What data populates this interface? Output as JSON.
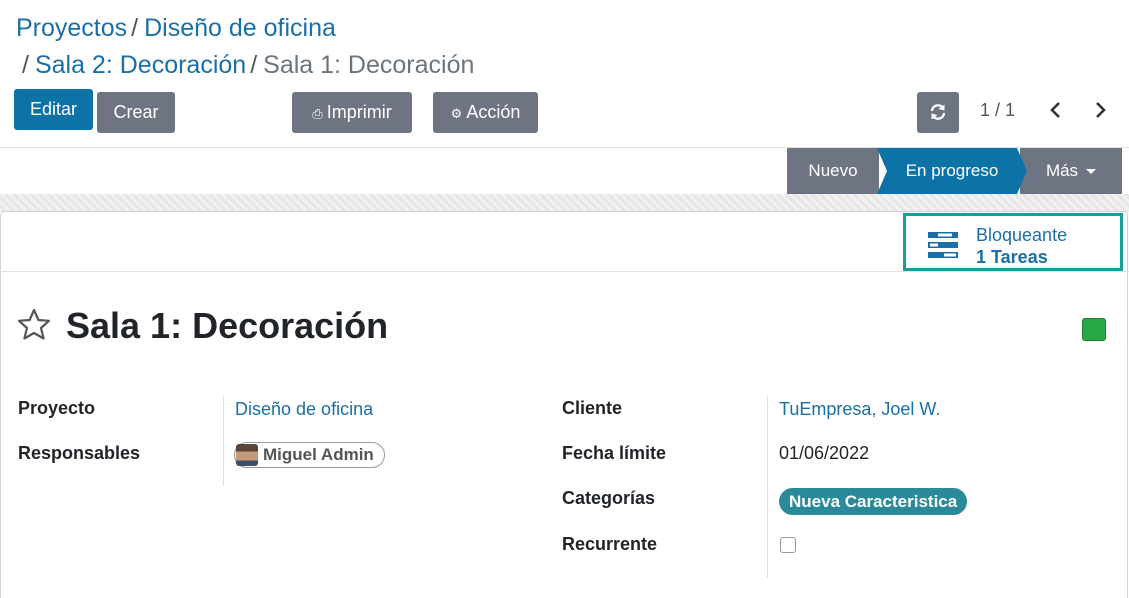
{
  "breadcrumb": {
    "items": [
      "Proyectos",
      "Diseño de oficina",
      "Sala 2: Decoración"
    ],
    "current": "Sala 1: Decoración",
    "separator": "/"
  },
  "toolbar": {
    "edit_label": "Editar",
    "create_label": "Crear",
    "print_label": "Imprimir",
    "action_label": "Acción",
    "pager": "1 / 1"
  },
  "stages": {
    "new": "Nuevo",
    "in_progress": "En progreso",
    "more": "Más"
  },
  "smart_button": {
    "label": "Bloqueante",
    "count": "1 Tareas"
  },
  "record": {
    "title": "Sala 1: Decoración",
    "kanban_state_color": "#28a745"
  },
  "fields": {
    "project_label": "Proyecto",
    "project_value": "Diseño de oficina",
    "assignees_label": "Responsables",
    "assignee_value": "Miguel Admin",
    "customer_label": "Cliente",
    "customer_value": "TuEmpresa, Joel W.",
    "deadline_label": "Fecha límite",
    "deadline_value": "01/06/2022",
    "tags_label": "Categorías",
    "tag_value": "Nueva Caracteristica",
    "recurring_label": "Recurrente"
  },
  "colors": {
    "primary": "#0d73a6",
    "secondary": "#6f7482",
    "link": "#1a6fa6",
    "highlight": "#13a09a",
    "tag": "#2a8a9a"
  }
}
